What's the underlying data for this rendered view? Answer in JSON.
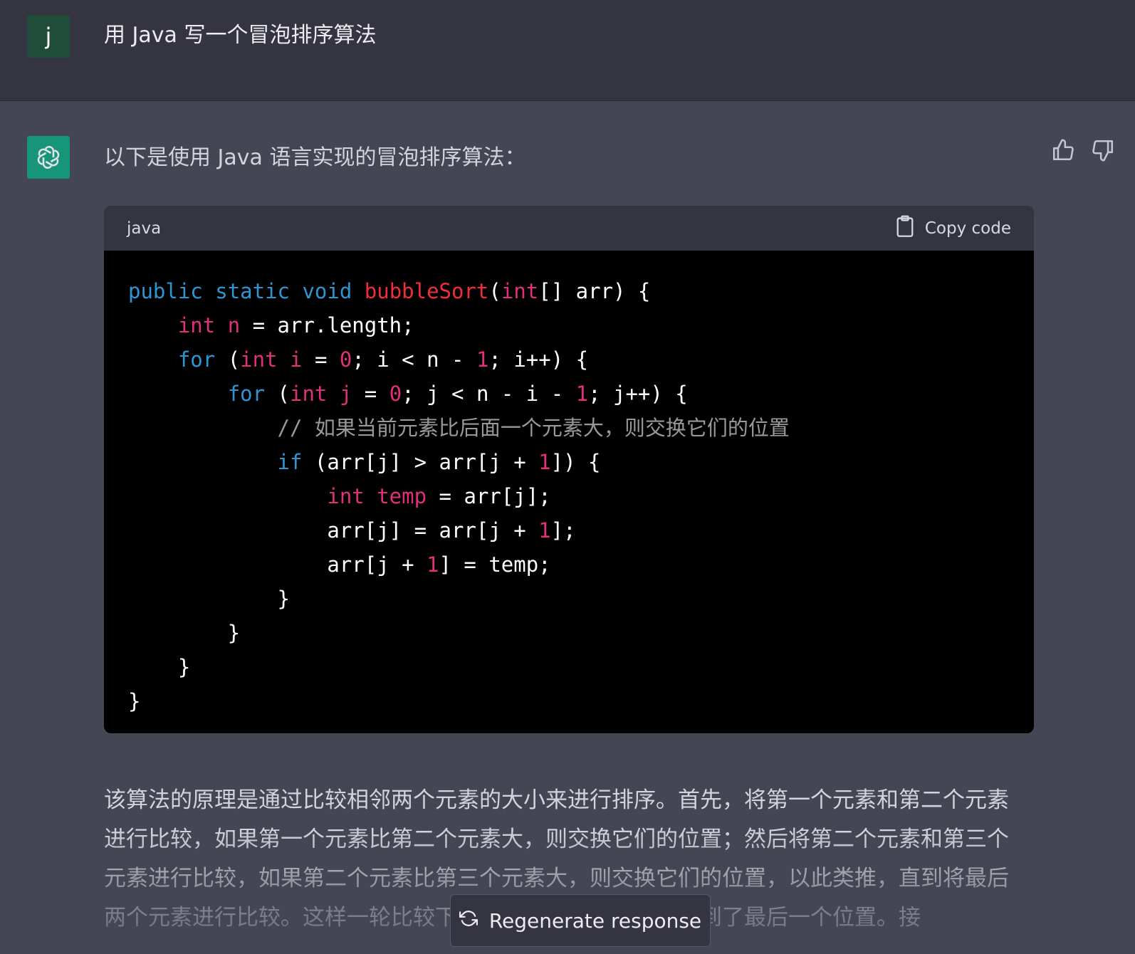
{
  "user_message": {
    "avatar_letter": "j",
    "text": "用 Java 写一个冒泡排序算法"
  },
  "assistant": {
    "intro": "以下是使用 Java 语言实现的冒泡排序算法：",
    "code_block": {
      "language": "java",
      "copy_label": "Copy code",
      "lines": [
        "public static void bubbleSort(int[] arr) {",
        "    int n = arr.length;",
        "    for (int i = 0; i < n - 1; i++) {",
        "        for (int j = 0; j < n - i - 1; j++) {",
        "            // 如果当前元素比后面一个元素大，则交换它们的位置",
        "            if (arr[j] > arr[j + 1]) {",
        "                int temp = arr[j];",
        "                arr[j] = arr[j + 1];",
        "                arr[j + 1] = temp;",
        "            }",
        "        }",
        "    }",
        "}"
      ]
    },
    "explanation": "该算法的原理是通过比较相邻两个元素的大小来进行排序。首先，将第一个元素和第二个元素进行比较，如果第一个元素比第二个元素大，则交换它们的位置；然后将第二个元素和第三个元素进行比较，如果第二个元素比第三个元素大，则交换它们的位置，以此类推，直到将最后两个元素进行比较。这样一轮比较下来，最大的元素就被移动到了最后一个位置。接"
  },
  "regenerate_label": "Regenerate response",
  "icons": {
    "thumbs_up": "thumbs-up-icon",
    "thumbs_down": "thumbs-down-icon",
    "clipboard": "clipboard-icon",
    "refresh": "refresh-icon",
    "bot_logo": "openai-logo-icon"
  },
  "colors": {
    "user_bg": "#343541",
    "assistant_bg": "#444654",
    "code_bg": "#000000",
    "keyword": "#2e95d3",
    "type": "#df3079",
    "function": "#f22c3d",
    "comment": "#999999"
  }
}
